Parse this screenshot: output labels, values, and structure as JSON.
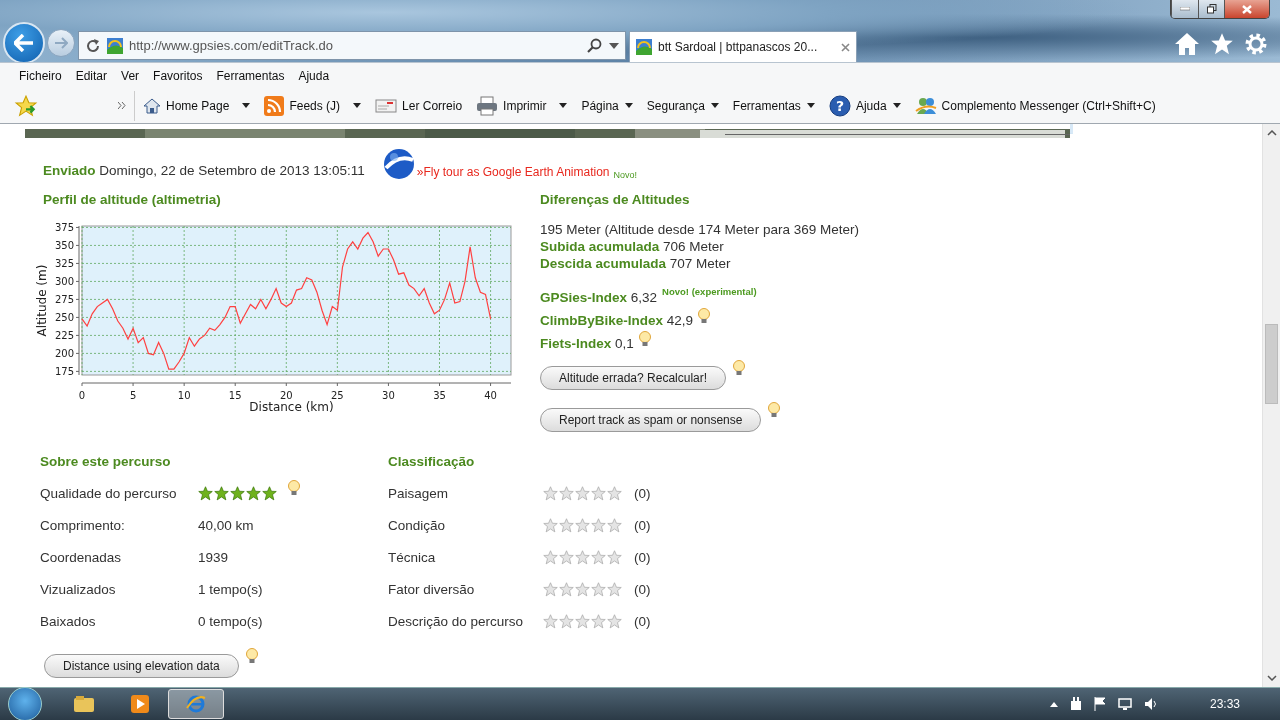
{
  "address_bar": {
    "url": "http://www.gpsies.com/editTrack.do"
  },
  "tabs": [
    {
      "title": "btt Sardoal | bttpanascos 20...",
      "selected": true
    }
  ],
  "menu": [
    "Ficheiro",
    "Editar",
    "Ver",
    "Favoritos",
    "Ferramentas",
    "Ajuda"
  ],
  "command_bar": [
    {
      "label": "Home Page",
      "dropdown": true
    },
    {
      "label": "Feeds (J)",
      "dropdown": true
    },
    {
      "label": "Ler Correio",
      "dropdown": false
    },
    {
      "label": "Imprimir",
      "dropdown": true
    },
    {
      "label": "Página",
      "dropdown": true
    },
    {
      "label": "Segurança",
      "dropdown": true
    },
    {
      "label": "Ferramentas",
      "dropdown": true
    },
    {
      "label": "Ajuda",
      "icon_glyph": "?",
      "dropdown": true
    },
    {
      "label": "Complemento Messenger (Ctrl+Shift+C)",
      "dropdown": false
    }
  ],
  "page": {
    "posted": {
      "label": "Enviado",
      "date": "Domingo, 22 de Setembro de 2013 13:05:11"
    },
    "fly_tour": {
      "text": "»Fly tour as Google Earth Animation",
      "badge": "Novo!"
    },
    "profile": {
      "title": "Perfil de altitude (altimetria)",
      "chart_data": {
        "type": "line",
        "grid": true,
        "xlabel": "Distance (km)",
        "ylabel": "Altitude (m)",
        "xlim": [
          0,
          42
        ],
        "ylim": [
          170,
          377
        ],
        "xticks": [
          0,
          5,
          10,
          15,
          20,
          25,
          30,
          35,
          40
        ],
        "yticks": [
          175,
          200,
          225,
          250,
          275,
          300,
          325,
          350,
          375
        ],
        "x": [
          0,
          0.5,
          1,
          1.5,
          2,
          2.5,
          3,
          3.5,
          4,
          4.5,
          5,
          5.5,
          6,
          6.5,
          7,
          7.5,
          8,
          8.5,
          9,
          9.5,
          10,
          10.5,
          11,
          11.5,
          12,
          12.5,
          13,
          13.5,
          14,
          14.5,
          15,
          15.5,
          16,
          16.5,
          17,
          17.5,
          18,
          18.5,
          19,
          19.5,
          20,
          20.5,
          21,
          21.5,
          22,
          22.5,
          23,
          23.5,
          24,
          24.5,
          25,
          25.5,
          26,
          26.5,
          27,
          27.5,
          28,
          28.5,
          29,
          29.5,
          30,
          30.5,
          31,
          31.5,
          32,
          32.5,
          33,
          33.5,
          34,
          34.5,
          35,
          35.5,
          36,
          36.5,
          37,
          37.5,
          38,
          38.5,
          39,
          39.5,
          40
        ],
        "series": [
          {
            "color": "#ff4040",
            "values": [
              248,
              238,
              255,
              265,
              270,
              275,
              262,
              245,
              235,
              220,
              235,
              215,
              222,
              200,
              198,
              215,
              200,
              178,
              178,
              188,
              200,
              222,
              210,
              220,
              225,
              235,
              232,
              240,
              250,
              265,
              265,
              242,
              255,
              268,
              262,
              275,
              262,
              275,
              290,
              270,
              265,
              270,
              288,
              290,
              305,
              302,
              285,
              260,
              240,
              265,
              260,
              320,
              345,
              355,
              345,
              360,
              368,
              355,
              335,
              345,
              345,
              330,
              310,
              312,
              295,
              290,
              280,
              290,
              270,
              255,
              260,
              275,
              298,
              270,
              272,
              300,
              348,
              305,
              285,
              282,
              248
            ]
          }
        ]
      }
    },
    "altitude_differences": {
      "title": "Diferenças de Altitudes",
      "summary": "195 Meter (Altitude desde 174 Meter para 369 Meter)",
      "stats": [
        {
          "label": "Subida acumulada",
          "value": "706 Meter"
        },
        {
          "label": "Descida acumulada",
          "value": "707 Meter"
        }
      ],
      "indexes": [
        {
          "label": "GPSies-Index",
          "value": "6,32",
          "note": "Novo! (experimental)",
          "hint": false
        },
        {
          "label": "ClimbByBike-Index",
          "value": "42,9",
          "hint": true
        },
        {
          "label": "Fiets-Index",
          "value": "0,1",
          "hint": true
        }
      ],
      "buttons": [
        {
          "label": "Altitude errada? Recalcular!",
          "hint": true
        },
        {
          "label": "Report track as spam or nonsense",
          "hint": true
        }
      ]
    },
    "about": {
      "title": "Sobre este percurso",
      "rows": [
        {
          "kind": "stars",
          "label": "Qualidade do percurso",
          "stars": 5,
          "hint": true
        },
        {
          "kind": "text",
          "label": "Comprimento:",
          "value": "40,00 km"
        },
        {
          "kind": "text",
          "label": "Coordenadas",
          "value": "1939"
        },
        {
          "kind": "text",
          "label": "Vizualizados",
          "value": "1 tempo(s)"
        },
        {
          "kind": "text",
          "label": "Baixados",
          "value": "0 tempo(s)"
        }
      ]
    },
    "rating": {
      "title": "Classificação",
      "rows": [
        {
          "label": "Paisagem",
          "stars": 0,
          "count": "(0)"
        },
        {
          "label": "Condição",
          "stars": 0,
          "count": "(0)"
        },
        {
          "label": "Técnica",
          "stars": 0,
          "count": "(0)"
        },
        {
          "label": "Fator diversão",
          "stars": 0,
          "count": "(0)"
        },
        {
          "label": "Descrição do percurso",
          "stars": 0,
          "count": "(0)"
        }
      ]
    },
    "bottom_button": {
      "label": "Distance using elevation data",
      "hint": true
    }
  },
  "taskbar": {
    "clock": "23:33"
  }
}
